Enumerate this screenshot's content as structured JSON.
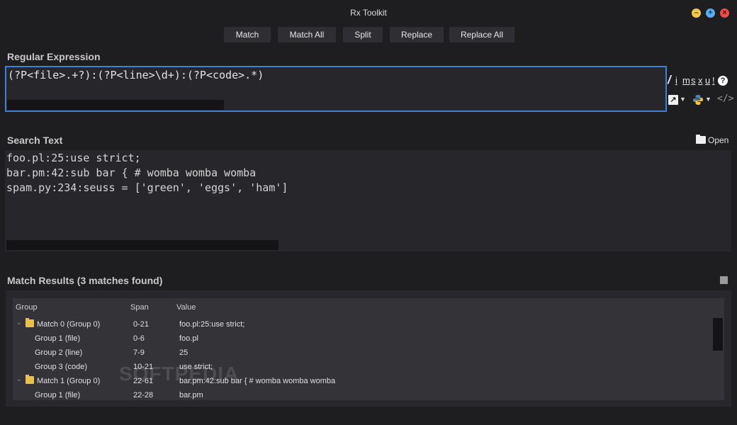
{
  "window": {
    "title": "Rx Toolkit"
  },
  "toolbar": {
    "match": "Match",
    "match_all": "Match All",
    "split": "Split",
    "replace": "Replace",
    "replace_all": "Replace All"
  },
  "regex_section": {
    "title": "Regular Expression",
    "value": "(?P<file>.+?):(?P<line>\\d+):(?P<code>.*)",
    "flags": [
      "/",
      "i",
      "m",
      "s",
      "x",
      "u",
      "!"
    ],
    "help": "?"
  },
  "search_section": {
    "title": "Search Text",
    "open_label": "Open",
    "lines": [
      "foo.pl:25:use strict;",
      "bar.pm:42:sub bar { # womba womba womba",
      "spam.py:234:seuss = ['green', 'eggs', 'ham']"
    ]
  },
  "results_section": {
    "title": "Match Results (3 matches found)",
    "columns": [
      "Group",
      "Span",
      "Value"
    ],
    "rows": [
      {
        "group": "Match 0 (Group 0)",
        "span": "0-21",
        "value": "foo.pl:25:use strict;"
      },
      {
        "group": "Group 1 (file)",
        "span": "0-6",
        "value": "foo.pl"
      },
      {
        "group": "Group 2 (line)",
        "span": "7-9",
        "value": "25"
      },
      {
        "group": "Group 3 (code)",
        "span": "10-21",
        "value": "use strict;"
      },
      {
        "group": "Match 1 (Group 0)",
        "span": "22-61",
        "value": "bar.pm:42:sub bar { # womba womba womba"
      },
      {
        "group": "Group 1 (file)",
        "span": "22-28",
        "value": "bar.pm"
      }
    ]
  },
  "watermark": "SOFTPEDIA"
}
